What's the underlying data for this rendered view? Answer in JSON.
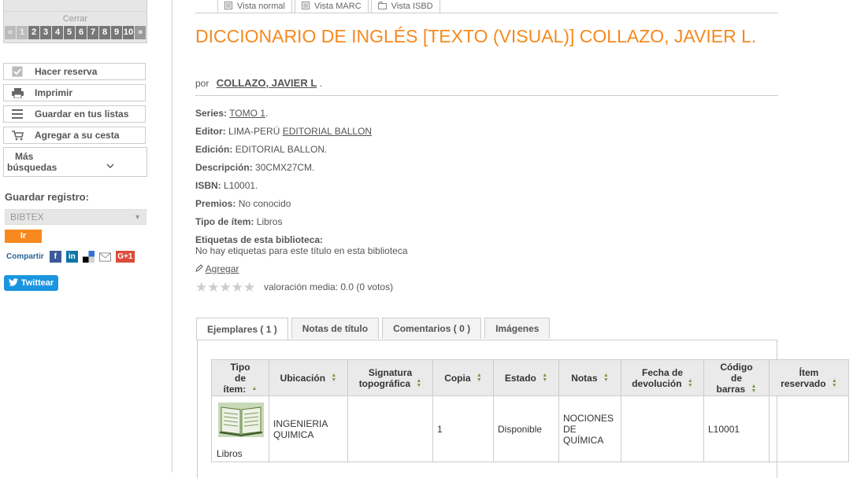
{
  "sidebar": {
    "pager": {
      "close_label": "Cerrar",
      "prev": "«",
      "pages": [
        "1",
        "2",
        "3",
        "4",
        "5",
        "6",
        "7",
        "8",
        "9",
        "10"
      ],
      "next": "»"
    },
    "actions": {
      "reserve": "Hacer reserva",
      "print": "Imprimir",
      "save_lists": "Guardar en tus listas",
      "add_cart": "Agregar a su cesta",
      "more_line1": "Más",
      "more_line2": "búsquedas"
    },
    "save_record": {
      "title": "Guardar registro:",
      "format": "BIBTEX",
      "go": "Ir"
    },
    "share": {
      "label": "Compartir",
      "facebook": "f",
      "linkedin": "in",
      "googleplus": "G+1"
    },
    "twitter": "Twittear"
  },
  "views": {
    "normal": "Vista normal",
    "marc": "Vista MARC",
    "isbd": "Vista ISBD"
  },
  "record": {
    "title": "DICCIONARIO DE INGLÉS [TEXTO (VISUAL)] COLLAZO, JAVIER L.",
    "by": "por",
    "author": "COLLAZO, JAVIER L",
    "author_end": ".",
    "fields": {
      "series_label": "Series:",
      "series_value": "TOMO 1",
      "series_end": ".",
      "editor_label": "Editor:",
      "editor_place": "LIMA-PERÚ",
      "editor_value": "EDITORIAL BALLON",
      "edition_label": "Edición:",
      "edition_value": "EDITORIAL BALLON.",
      "description_label": "Descripción:",
      "description_value": "30CMX27CM.",
      "isbn_label": "ISBN:",
      "isbn_value": "L10001.",
      "awards_label": "Premios:",
      "awards_value": "No conocido",
      "itemtype_label": "Tipo de ítem:",
      "itemtype_value": "Libros",
      "tags_label": "Etiquetas de esta biblioteca:",
      "tags_value": "No hay etiquetas para este título en esta biblioteca"
    },
    "add_tag": "Agregar",
    "rating": "valoración media: 0.0 (0 votos)"
  },
  "tabs": [
    "Ejemplares ( 1 )",
    "Notas de título",
    "Comentarios ( 0 )",
    "Imágenes"
  ],
  "table": {
    "headers": {
      "type": [
        "Tipo",
        "de",
        "ítem:"
      ],
      "location": "Ubicación",
      "callnumber": [
        "Signatura",
        "topográfica"
      ],
      "copy": "Copia",
      "status": "Estado",
      "notes": "Notas",
      "due": [
        "Fecha de",
        "devolución"
      ],
      "barcode": [
        "Código",
        "de",
        "barras"
      ],
      "reserved": [
        "Ítem",
        "reservado"
      ]
    },
    "row": {
      "type": "Libros",
      "location": [
        "INGENIERIA",
        "QUIMICA"
      ],
      "callnumber": "",
      "copy": "1",
      "status": "Disponible",
      "notes": [
        "NOCIONES",
        "DE",
        "QUÍMICA"
      ],
      "due": "",
      "barcode": "L10001",
      "reserved": ""
    }
  }
}
